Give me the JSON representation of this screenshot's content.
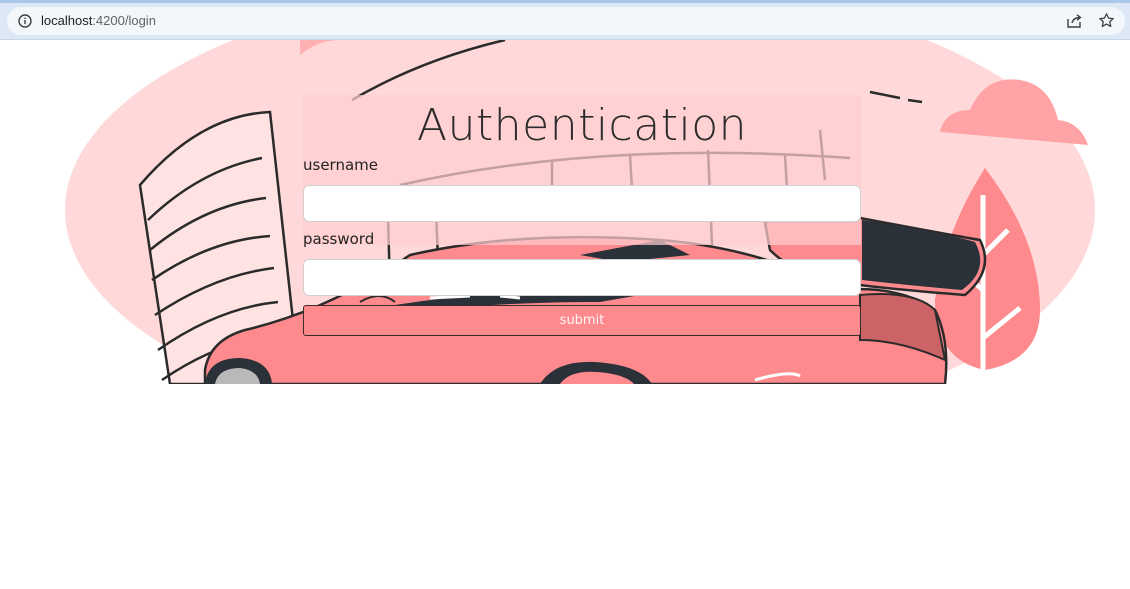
{
  "browser": {
    "url_host": "localhost",
    "url_rest": ":4200/login",
    "icons": [
      "info-icon",
      "share-icon",
      "star-icon"
    ]
  },
  "login": {
    "title": "Authentication",
    "username_label": "username",
    "password_label": "password",
    "username_value": "",
    "password_value": "",
    "submit_label": "submit"
  },
  "colors": {
    "accent": "#ff8a8e",
    "background_blob": "#ffd6d7",
    "car": "#ff8a8e",
    "tree": "#ff8a8e"
  }
}
